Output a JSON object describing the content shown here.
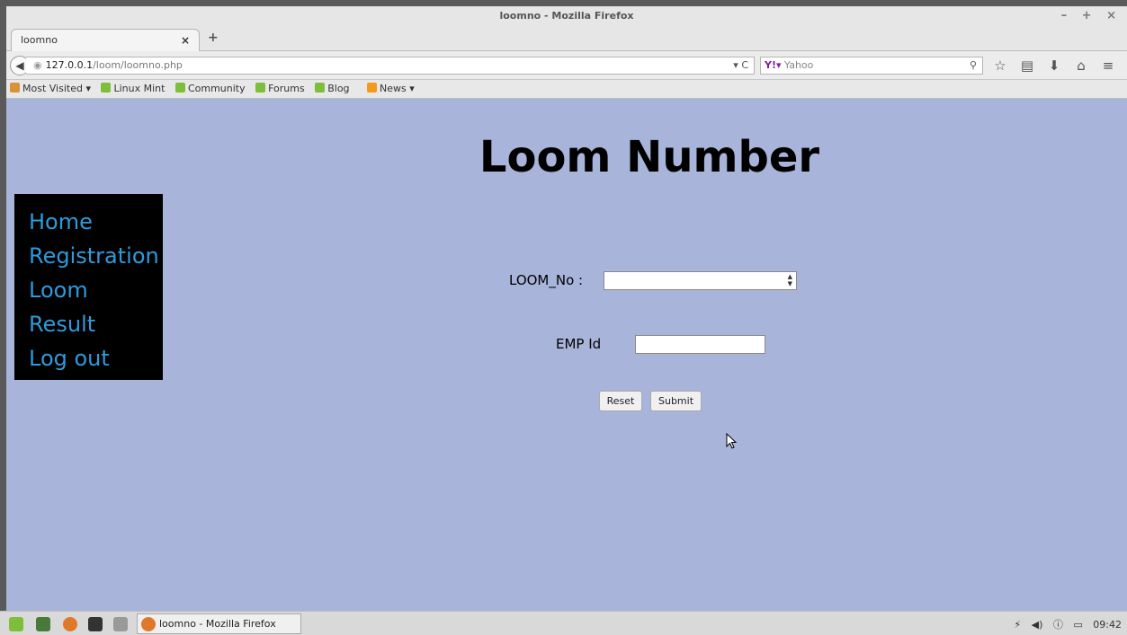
{
  "window": {
    "title": "loomno - Mozilla Firefox",
    "controls": "– + ×"
  },
  "tabs": [
    {
      "label": "loomno"
    }
  ],
  "navbar": {
    "url_host": "127.0.0.1",
    "url_path": "/loom/loomno.php",
    "url_controls": "▾ C",
    "search_engine": "Yahoo",
    "search_placeholder": "Yahoo"
  },
  "bookmarks": [
    {
      "label": "Most Visited ▾",
      "icon": "folder"
    },
    {
      "label": "Linux Mint",
      "icon": "mint"
    },
    {
      "label": "Community",
      "icon": "mint"
    },
    {
      "label": "Forums",
      "icon": "mint"
    },
    {
      "label": "Blog",
      "icon": "mint"
    },
    {
      "label": "News ▾",
      "icon": "rss"
    }
  ],
  "page": {
    "title": "Loom Number",
    "menu": [
      "Home",
      "Registration",
      "Loom",
      "Result",
      "Log out"
    ],
    "form": {
      "loom_label": "LOOM_No :",
      "loom_value": "",
      "emp_label": "EMP Id",
      "emp_value": "",
      "reset_label": "Reset",
      "submit_label": "Submit"
    },
    "background_color": "#a8b4d9",
    "menu_link_color": "#2d9bdc"
  },
  "taskbar": {
    "task_label": "loomno - Mozilla Firefox",
    "clock": "09:42"
  }
}
